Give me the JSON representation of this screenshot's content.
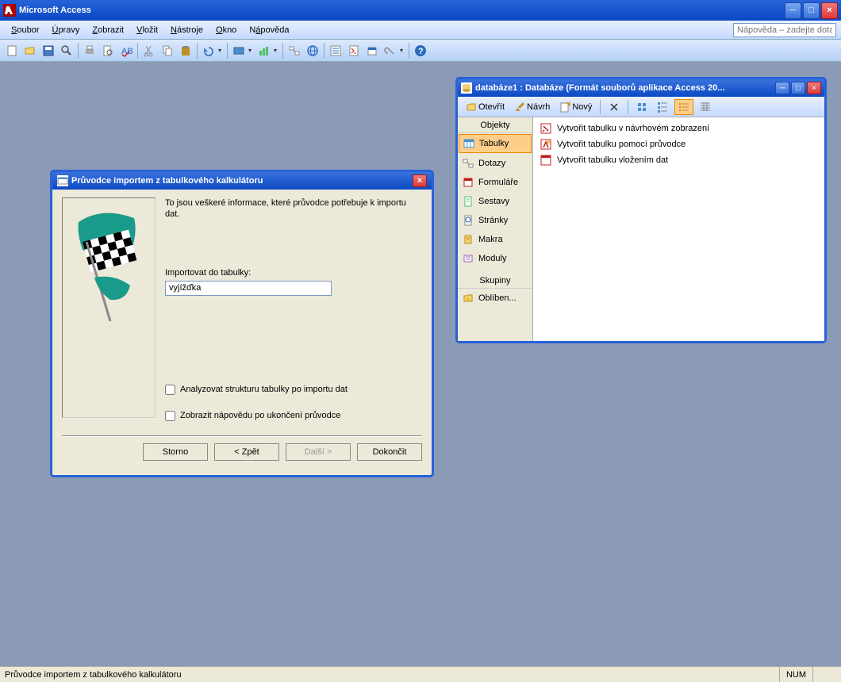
{
  "app": {
    "title": "Microsoft Access"
  },
  "menu": {
    "items": [
      {
        "label": "Soubor",
        "u": "S"
      },
      {
        "label": "Úpravy",
        "u": "Ú"
      },
      {
        "label": "Zobrazit",
        "u": "Z"
      },
      {
        "label": "Vložit",
        "u": "V"
      },
      {
        "label": "Nástroje",
        "u": "N"
      },
      {
        "label": "Okno",
        "u": "O"
      },
      {
        "label": "Nápověda",
        "u": "á"
      }
    ],
    "help_placeholder": "Nápověda – zadejte dotaz"
  },
  "dbwin": {
    "title": "databáze1 : Databáze (Formát souborů aplikace Access 20...",
    "toolbar": {
      "open": "Otevřít",
      "design": "Návrh",
      "new": "Nový"
    },
    "sidebar": {
      "objects_header": "Objekty",
      "groups_header": "Skupiny",
      "items": [
        {
          "label": "Tabulky"
        },
        {
          "label": "Dotazy"
        },
        {
          "label": "Formuláře"
        },
        {
          "label": "Sestavy"
        },
        {
          "label": "Stránky"
        },
        {
          "label": "Makra"
        },
        {
          "label": "Moduly"
        }
      ],
      "groups": [
        {
          "label": "Oblíben..."
        }
      ]
    },
    "main": {
      "items": [
        {
          "label": "Vytvořit tabulku v návrhovém zobrazení"
        },
        {
          "label": "Vytvořit tabulku pomocí průvodce"
        },
        {
          "label": "Vytvořit tabulku vložením dat"
        }
      ]
    }
  },
  "wizard": {
    "title": "Průvodce importem z tabulkového kalkulátoru",
    "info": "To jsou veškeré informace, které průvodce potřebuje k importu dat.",
    "import_label": "Importovat do tabulky:",
    "import_value": "vyjížďka",
    "analyze_label": "Analyzovat strukturu tabulky po importu dat",
    "help_label": "Zobrazit nápovědu po ukončení průvodce",
    "buttons": {
      "cancel": "Storno",
      "back": "< Zpět",
      "next": "Další >",
      "finish": "Dokončit"
    }
  },
  "statusbar": {
    "text": "Průvodce importem z tabulkového kalkulátoru",
    "num": "NUM"
  }
}
